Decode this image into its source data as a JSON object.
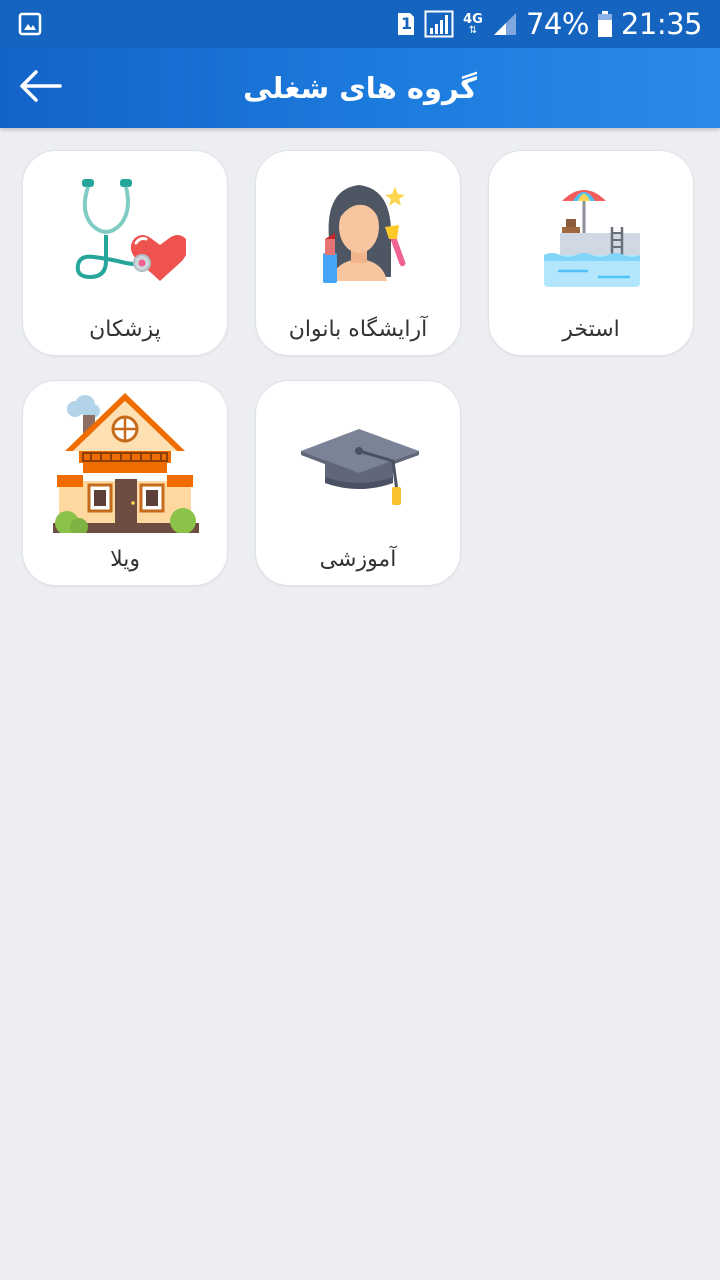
{
  "status_bar": {
    "sim_slot": "1",
    "network": "4G",
    "battery": "74%",
    "time": "21:35",
    "icons": [
      "gallery-icon",
      "sim-icon",
      "signal-icon",
      "network-4g-icon",
      "signal-icon",
      "battery-icon"
    ]
  },
  "app_bar": {
    "title": "گروه های شغلی",
    "back_icon": "arrow-left-icon"
  },
  "categories": [
    {
      "label": "استخر",
      "icon": "pool-icon"
    },
    {
      "label": "آرایشگاه بانوان",
      "icon": "beauty-salon-icon"
    },
    {
      "label": "پزشکان",
      "icon": "stethoscope-icon"
    },
    {
      "label": "آموزشی",
      "icon": "graduation-cap-icon"
    },
    {
      "label": "ویلا",
      "icon": "villa-house-icon"
    }
  ],
  "colors": {
    "status_bar": "#1565c0",
    "app_bar": "#1e7ee0",
    "background": "#eceef2",
    "card": "#ffffff"
  }
}
